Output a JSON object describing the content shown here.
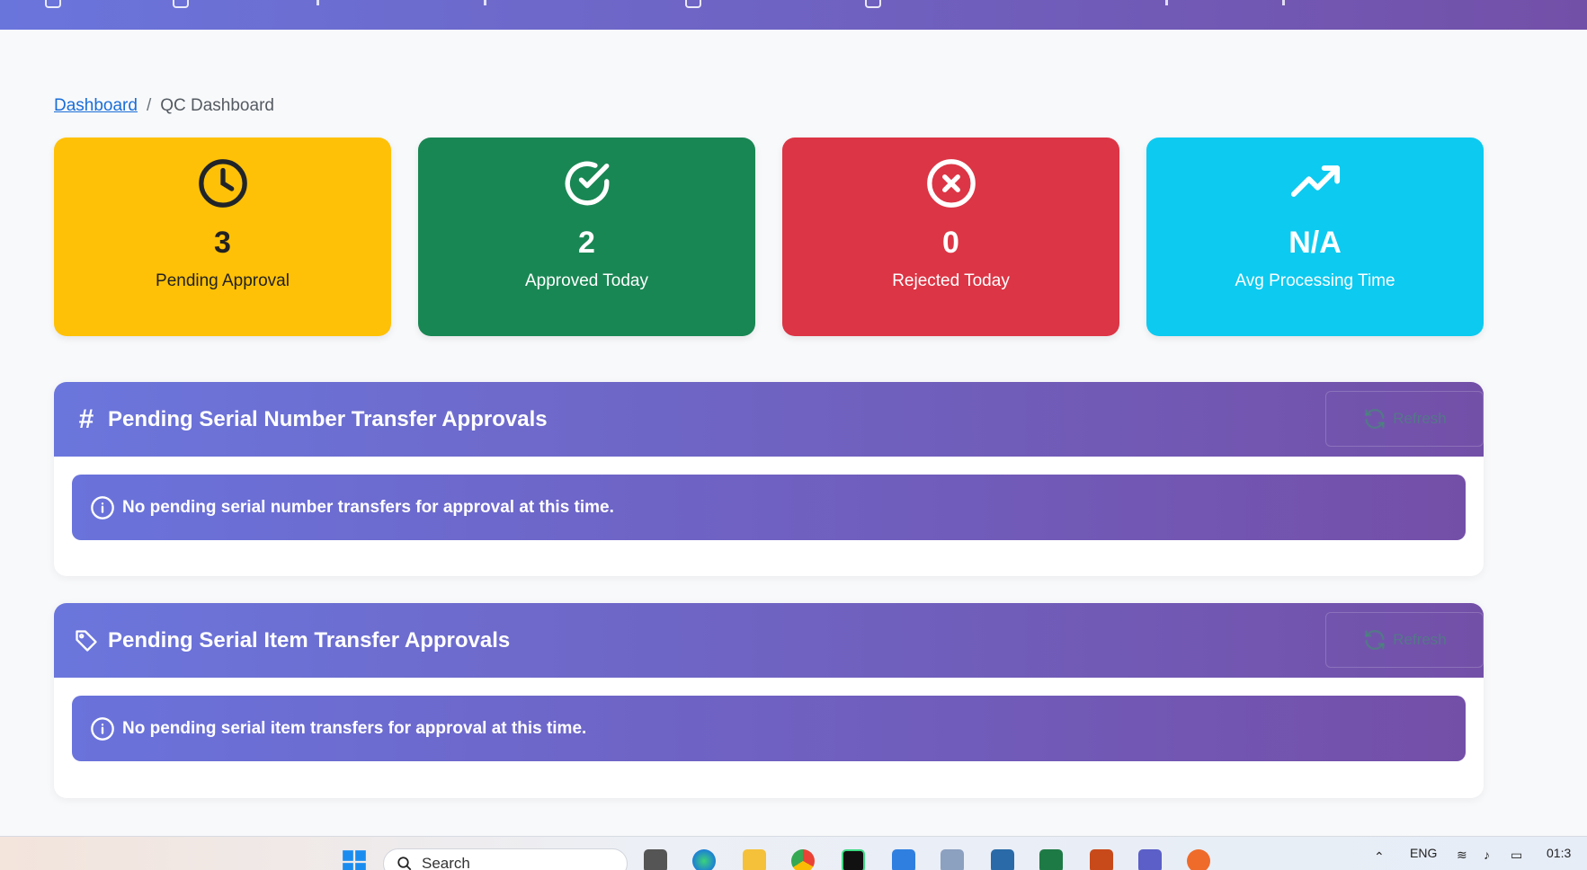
{
  "breadcrumb": {
    "home": "Dashboard",
    "separator": "/",
    "current": "QC Dashboard"
  },
  "stats": [
    {
      "value": "3",
      "label": "Pending Approval",
      "icon": "clock-icon",
      "color": "#ffc107"
    },
    {
      "value": "2",
      "label": "Approved Today",
      "icon": "check-circle-icon",
      "color": "#198754"
    },
    {
      "value": "0",
      "label": "Rejected Today",
      "icon": "x-circle-icon",
      "color": "#dc3545"
    },
    {
      "value": "N/A",
      "label": "Avg Processing Time",
      "icon": "trending-up-icon",
      "color": "#0dcaf0"
    }
  ],
  "panels": {
    "serial_number": {
      "title": "Pending Serial Number Transfer Approvals",
      "icon": "hash-icon",
      "refresh_label": "Refresh",
      "message": "No pending serial number transfers for approval at this time."
    },
    "serial_item": {
      "title": "Pending Serial Item Transfer Approvals",
      "icon": "tag-icon",
      "refresh_label": "Refresh",
      "message": "No pending serial item transfers for approval at this time."
    }
  },
  "taskbar": {
    "search_placeholder": "Search",
    "language": "ENG",
    "time": "01:3"
  },
  "colors": {
    "header_gradient_start": "#6a75dc",
    "header_gradient_end": "#7350a8"
  }
}
